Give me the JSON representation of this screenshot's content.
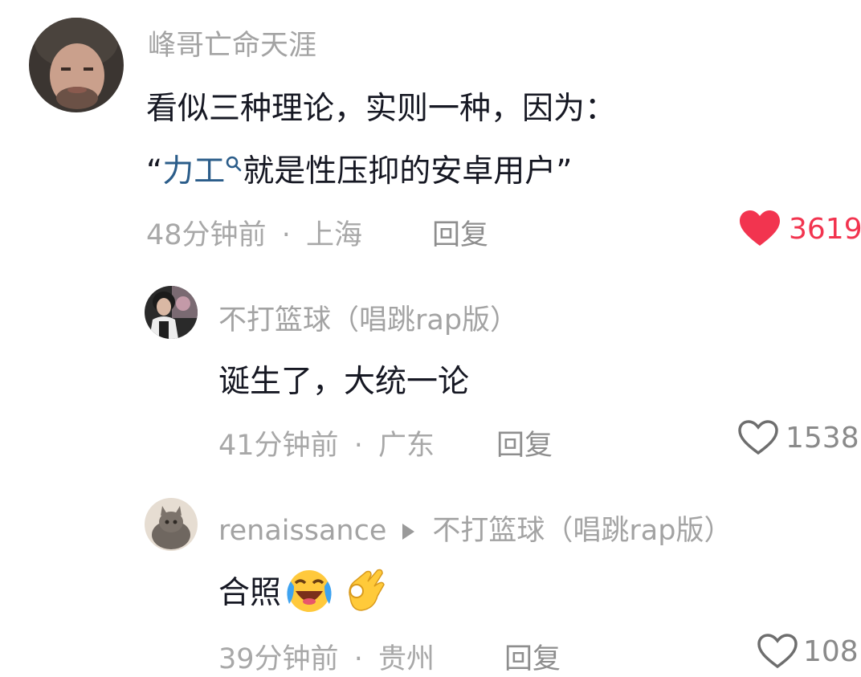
{
  "comments": [
    {
      "username": "峰哥亡命天涯",
      "text_line1": "看似三种理论，实则一种，因为：",
      "text_line2_open": "“",
      "text_line2_link": "力工",
      "text_line2_rest": "就是性压抑的安卓用户”",
      "time": "48分钟前",
      "sep": "·",
      "location": "上海",
      "reply_label": "回复",
      "likes": "3619",
      "liked": true,
      "heart_color": "#f2344f"
    },
    {
      "username": "不打篮球（唱跳rap版）",
      "text": "诞生了，大统一论",
      "time": "41分钟前",
      "sep": "·",
      "location": "广东",
      "reply_label": "回复",
      "likes": "1538",
      "liked": false
    },
    {
      "username": "renaissance",
      "reply_to": "不打篮球（唱跳rap版）",
      "text": "合照",
      "emojis": [
        "laughing-crying-emoji",
        "ok-hand-emoji"
      ],
      "time": "39分钟前",
      "sep": "·",
      "location": "贵州",
      "reply_label": "回复",
      "likes": "108",
      "liked": false
    }
  ]
}
